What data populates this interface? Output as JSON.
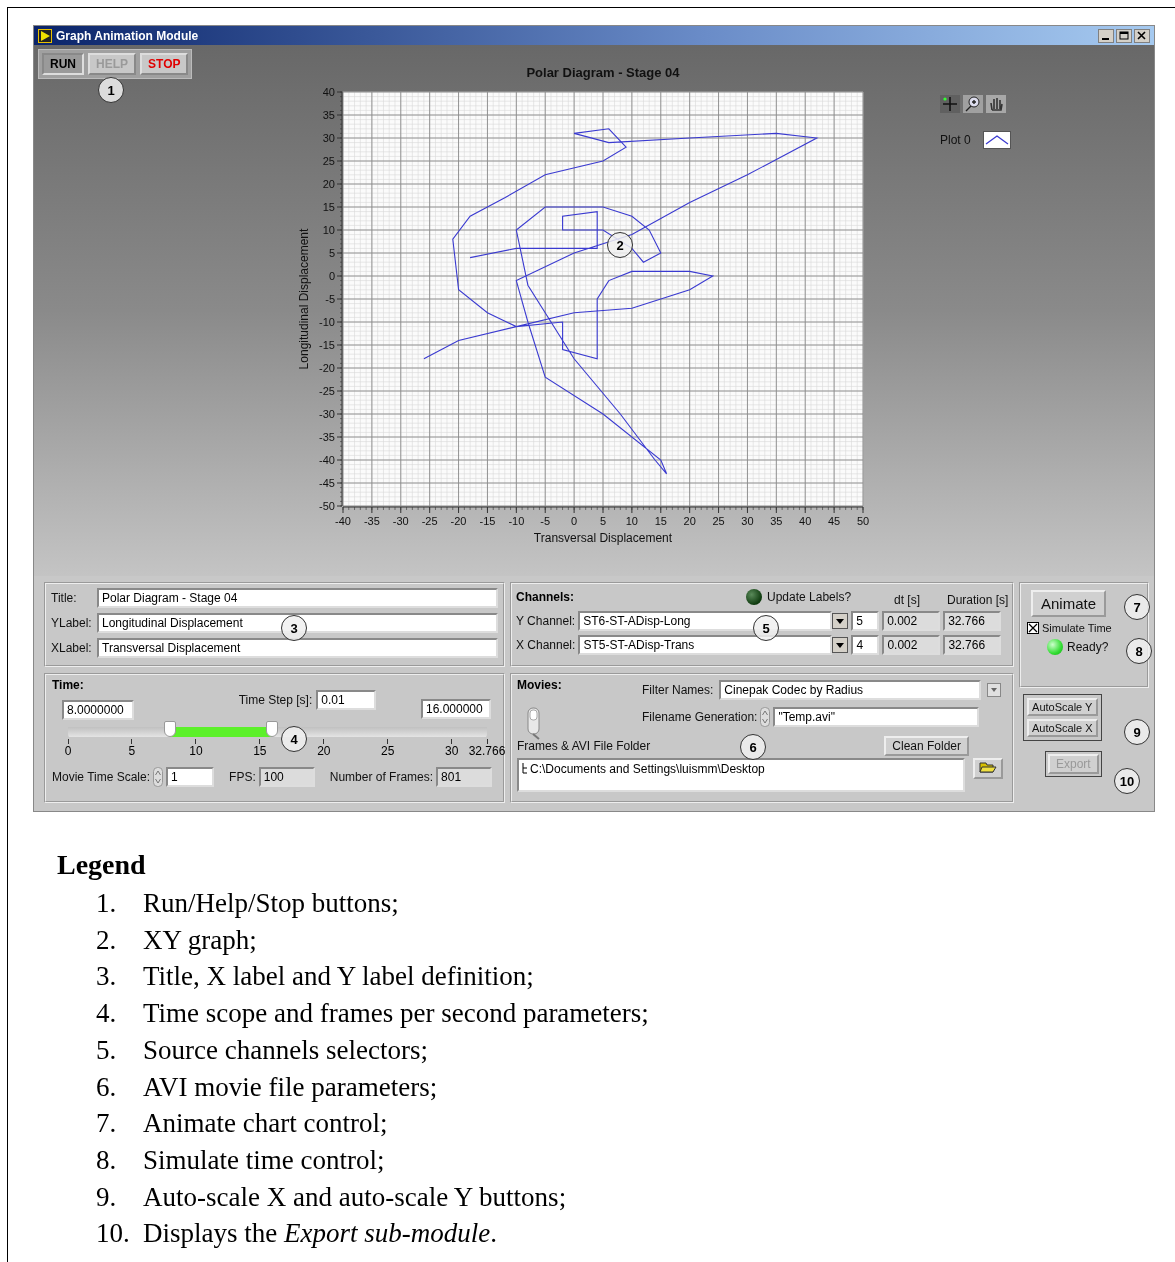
{
  "window": {
    "title": "Graph Animation Module"
  },
  "toolbar": [
    {
      "label": "RUN",
      "kind": "pressed"
    },
    {
      "label": "HELP",
      "kind": "disabled"
    },
    {
      "label": "STOP",
      "kind": "danger"
    }
  ],
  "graph": {
    "chart_data": {
      "type": "line",
      "grid": true,
      "title": "Polar Diagram - Stage 04",
      "xlabel": "Transversal Displacement",
      "ylabel": "Longitudinal Displacement",
      "xlim": [
        -40,
        50
      ],
      "ylim": [
        -50,
        40
      ],
      "xticks": [
        -40,
        -35,
        -30,
        -25,
        -20,
        -15,
        -10,
        -5,
        0,
        5,
        10,
        15,
        20,
        25,
        30,
        35,
        40,
        45,
        50
      ],
      "yticks": [
        -50,
        -45,
        -40,
        -35,
        -30,
        -25,
        -20,
        -15,
        -10,
        -5,
        0,
        5,
        10,
        15,
        20,
        25,
        30,
        35,
        40
      ],
      "x": [
        -26,
        -20,
        -10,
        0,
        10,
        20,
        24,
        20,
        10,
        6,
        4,
        4,
        -2,
        -2,
        -10,
        -15,
        -20,
        -21,
        -18,
        -12,
        -5,
        5,
        9,
        6,
        0,
        6,
        20,
        35,
        42,
        30,
        20,
        10,
        0,
        -10,
        -8,
        -5,
        5,
        15,
        16,
        14,
        8,
        0,
        -8,
        -10,
        -5,
        5,
        10,
        13,
        15,
        12,
        10,
        5,
        -2,
        -2,
        4,
        4,
        -10,
        -18
      ],
      "series": [
        {
          "name": "Plot 0",
          "color": "#3a3ad0",
          "values": [
            -18,
            -14,
            -11,
            -8,
            -7,
            -3,
            0,
            1,
            1,
            -1,
            -5,
            -18,
            -16,
            -10,
            -11,
            -8,
            -3,
            8,
            13,
            17,
            22,
            25,
            28,
            32,
            31,
            29,
            30,
            31,
            30,
            22,
            16,
            9,
            5,
            -1,
            -10,
            -22,
            -30,
            -40,
            -43,
            -40,
            -30,
            -18,
            -2,
            10,
            15,
            15,
            13,
            10,
            5,
            3,
            6,
            10,
            10,
            13,
            14,
            6,
            6,
            4
          ]
        }
      ]
    }
  },
  "labels_panel": {
    "fields": [
      {
        "label": "Title:",
        "value": "Polar Diagram - Stage 04"
      },
      {
        "label": "YLabel:",
        "value": "Longitudinal Displacement"
      },
      {
        "label": "XLabel:",
        "value": "Transversal Displacement"
      }
    ]
  },
  "time_panel": {
    "heading": "Time:",
    "start": "8.0000000",
    "time_step_label": "Time Step [s]:",
    "time_step": "0.01",
    "end": "16.000000",
    "range": {
      "low": {
        "level": 0.244
      },
      "high": {
        "level": 0.488
      }
    },
    "ticks": [
      "0",
      "5",
      "10",
      "15",
      "20",
      "25",
      "30",
      "32.766"
    ],
    "movie_time_scale_label": "Movie Time Scale:",
    "movie_time_scale": "1",
    "fps_label": "FPS:",
    "fps": "100",
    "frames_label": "Number of Frames:",
    "frames": "801"
  },
  "channels_panel": {
    "heading": "Channels:",
    "update_labels": {
      "label": "Update Labels?",
      "on": false
    },
    "columns": [
      "dt [s]",
      "Duration [s]"
    ],
    "rows": [
      {
        "label": "Y Channel:",
        "value": "ST6-ST-ADisp-Long",
        "index": "5",
        "dt": "0.002",
        "duration": "32.766"
      },
      {
        "label": "X Channel:",
        "value": "ST5-ST-ADisp-Trans",
        "index": "4",
        "dt": "0.002",
        "duration": "32.766"
      }
    ]
  },
  "movies_panel": {
    "heading": "Movies:",
    "toggle": {
      "on": false
    },
    "filter_label": "Filter Names:",
    "filter": "Cinepak Codec by Radius",
    "filename_label": "Filename Generation:",
    "filename": "\"Temp.avi\"",
    "folder_label": "Frames & AVI File Folder",
    "folder": "C:\\Documents and Settings\\luismm\\Desktop",
    "clean_button": "Clean Folder"
  },
  "control_panel": {
    "animate": "Animate",
    "simulate": {
      "label": "Simulate Time",
      "checked": true
    },
    "ready": {
      "label": "Ready?",
      "on": true
    },
    "autoscale": [
      "AutoScale Y",
      "AutoScale X"
    ],
    "export": {
      "label": "Export",
      "disabled": true
    }
  },
  "callouts": [
    "1",
    "2",
    "3",
    "4",
    "5",
    "6",
    "7",
    "8",
    "9",
    "10"
  ],
  "legend": {
    "title": "Legend",
    "items": [
      {
        "number": "1.",
        "text": "Run/Help/Stop buttons;"
      },
      {
        "number": "2.",
        "text": "XY graph;"
      },
      {
        "number": "3.",
        "text": "Title, X label and Y label definition;"
      },
      {
        "number": "4.",
        "text": "Time scope and frames per second parameters;"
      },
      {
        "number": "5.",
        "text": "Source channels selectors;"
      },
      {
        "number": "6.",
        "text": "AVI movie file parameters;"
      },
      {
        "number": "7.",
        "text": "Animate chart control;"
      },
      {
        "number": "8.",
        "text": "Simulate time control;"
      },
      {
        "number": "9.",
        "text": "Auto-scale X and auto-scale Y buttons;"
      },
      {
        "number": "10.",
        "text": "Displays the *Export sub-module*."
      }
    ]
  }
}
